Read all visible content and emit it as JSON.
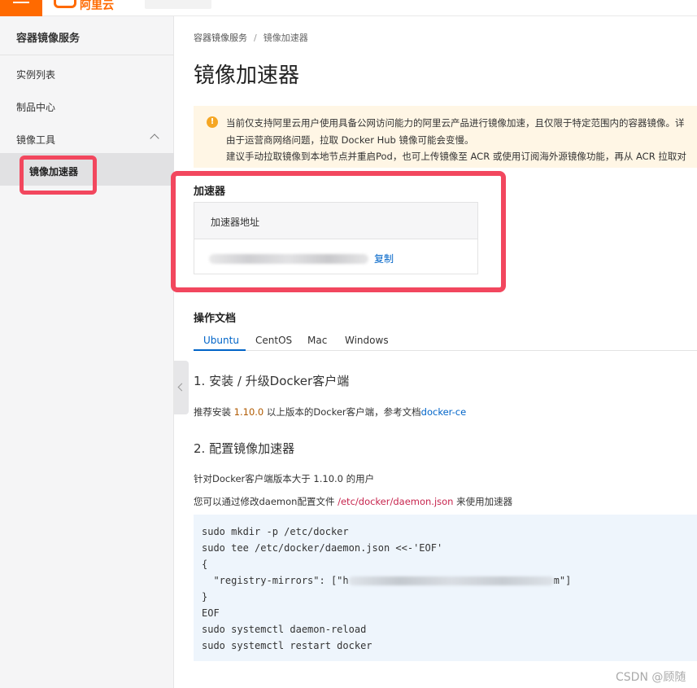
{
  "header": {
    "logo_text": "阿里云"
  },
  "sidebar": {
    "title": "容器镜像服务",
    "items": [
      {
        "label": "实例列表"
      },
      {
        "label": "制品中心"
      },
      {
        "label": "镜像工具"
      }
    ],
    "active_item": "镜像加速器"
  },
  "breadcrumb": {
    "root": "容器镜像服务",
    "separator": "/",
    "current": "镜像加速器"
  },
  "page_title": "镜像加速器",
  "notice": {
    "lines": [
      "当前仅支持阿里云用户使用具备公网访问能力的阿里云产品进行镜像加速，且仅限于特定范围内的容器镜像。详",
      "由于运营商网络问题，拉取 Docker Hub 镜像可能会变慢。",
      "建议手动拉取镜像到本地节点并重启Pod，也可上传镜像至 ACR 或使用订阅海外源镜像功能，再从 ACR 拉取对"
    ]
  },
  "accelerator": {
    "title": "加速器",
    "column_header": "加速器地址",
    "copy_label": "复制"
  },
  "docs": {
    "title": "操作文档",
    "tabs": [
      "Ubuntu",
      "CentOS",
      "Mac",
      "Windows"
    ],
    "active_tab": "Ubuntu",
    "step1": {
      "heading": "1. 安装 / 升级Docker客户端",
      "text_before": "推荐安装 ",
      "version": "1.10.0",
      "text_after": " 以上版本的Docker客户端，参考文档",
      "link": "docker-ce"
    },
    "step2": {
      "heading": "2. 配置镜像加速器",
      "line1": "针对Docker客户端版本大于 1.10.0 的用户",
      "line2_before": "您可以通过修改daemon配置文件 ",
      "line2_path": "/etc/docker/daemon.json",
      "line2_after": " 来使用加速器",
      "code_lines": [
        "sudo mkdir -p /etc/docker",
        "sudo tee /etc/docker/daemon.json <<-'EOF'",
        "{",
        "  \"registry-mirrors\": [\"h",
        "}",
        "EOF",
        "sudo systemctl daemon-reload",
        "sudo systemctl restart docker"
      ],
      "code_mirror_suffix": "m\"]"
    }
  },
  "watermark": "CSDN @顾随"
}
